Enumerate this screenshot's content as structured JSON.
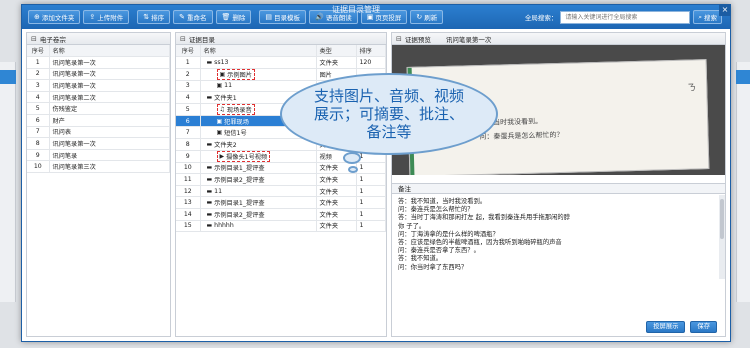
{
  "window": {
    "title": "证据目录管理"
  },
  "toolbar": {
    "add_folder": "添加文件夹",
    "upload": "上传附件",
    "sort": "排序",
    "rename": "重命名",
    "delete": "删除",
    "template": "目录模板",
    "voice_read": "语音朗读",
    "page_projection": "页页投屏",
    "refresh": "刷新"
  },
  "search": {
    "label": "全局搜索：",
    "placeholder": "请输入关键词进行全局搜索",
    "button": "搜索"
  },
  "left_panel": {
    "title": "电子卷宗",
    "columns": [
      "序号",
      "名称"
    ],
    "rows": [
      [
        "1",
        "讯问笔录第一次"
      ],
      [
        "2",
        "讯问笔录第一次"
      ],
      [
        "3",
        "讯问笔录第一次"
      ],
      [
        "4",
        "讯问笔录第二次"
      ],
      [
        "5",
        "伤残鉴定"
      ],
      [
        "6",
        "财产"
      ],
      [
        "7",
        "讯问表"
      ],
      [
        "8",
        "讯问笔录第一次"
      ],
      [
        "9",
        "讯问笔录"
      ],
      [
        "10",
        "讯问笔录第三次"
      ]
    ]
  },
  "mid_panel": {
    "title": "证据目录",
    "columns": [
      "序号",
      "名称",
      "类型",
      "排序"
    ],
    "rows": [
      {
        "no": "1",
        "name": "ss13",
        "kind": "folder",
        "type": "文件夹",
        "order": "120"
      },
      {
        "no": "2",
        "name": "示例图片",
        "kind": "image",
        "type": "图片",
        "order": "",
        "dashed": true
      },
      {
        "no": "3",
        "name": "11",
        "kind": "image",
        "type": "",
        "order": ""
      },
      {
        "no": "4",
        "name": "文件夹1",
        "kind": "folder",
        "type": "",
        "order": ""
      },
      {
        "no": "5",
        "name": "现场录音",
        "kind": "audio",
        "type": "",
        "order": "",
        "dashed": true
      },
      {
        "no": "6",
        "name": "犯罪现场",
        "kind": "image",
        "type": "",
        "order": "",
        "selected": true
      },
      {
        "no": "7",
        "name": "短信1号",
        "kind": "image",
        "type": "图片",
        "order": "1"
      },
      {
        "no": "8",
        "name": "文件夹2",
        "kind": "folder",
        "type": "文件夹",
        "order": "1"
      },
      {
        "no": "9",
        "name": "摄像头1号视频",
        "kind": "video",
        "type": "视频",
        "order": "1",
        "dashed": true
      },
      {
        "no": "10",
        "name": "示例目录1_提评查",
        "kind": "folder",
        "type": "文件夹",
        "order": "1"
      },
      {
        "no": "11",
        "name": "示例目录2_提评查",
        "kind": "folder",
        "type": "文件夹",
        "order": "1"
      },
      {
        "no": "12",
        "name": "11",
        "kind": "folder",
        "type": "文件夹",
        "order": "1"
      },
      {
        "no": "13",
        "name": "示例目录1_提评查",
        "kind": "folder",
        "type": "文件夹",
        "order": "1"
      },
      {
        "no": "14",
        "name": "示例目录2_提评查",
        "kind": "folder",
        "type": "文件夹",
        "order": "1"
      },
      {
        "no": "15",
        "name": "hhhhh",
        "kind": "folder",
        "type": "文件夹",
        "order": "1"
      }
    ]
  },
  "right_panel": {
    "title": "证据预览",
    "subtitle": "讯问笔录第一次",
    "paper_line1": "问：当时我没看到。",
    "paper_line2": "问：秦蛋兵是怎么帮忙的？",
    "notes_title": "备注",
    "notes": [
      "答：我不知道，当时我没看到。",
      "问：秦连兵是怎么帮忙的？",
      "答：当时丁海涛和那闲打左    起，我看到秦连兵用手拖那闲的脖",
      "你 子了。",
      "问：丁海涛拿的是什么样的啤酒瓶？",
      "答：应该是绿色的半截啤酒瓶，因为我听到啪啪碎瓶的声音",
      "问：秦连兵是否拿了东西？。",
      "答：我不知道。",
      "问：你当时拿了东西吗？"
    ],
    "projection_button": "投屏展示",
    "save_button": "保存"
  },
  "callout": {
    "text": "支持图片、音频、视频展示；可摘要、批注、备注等"
  }
}
